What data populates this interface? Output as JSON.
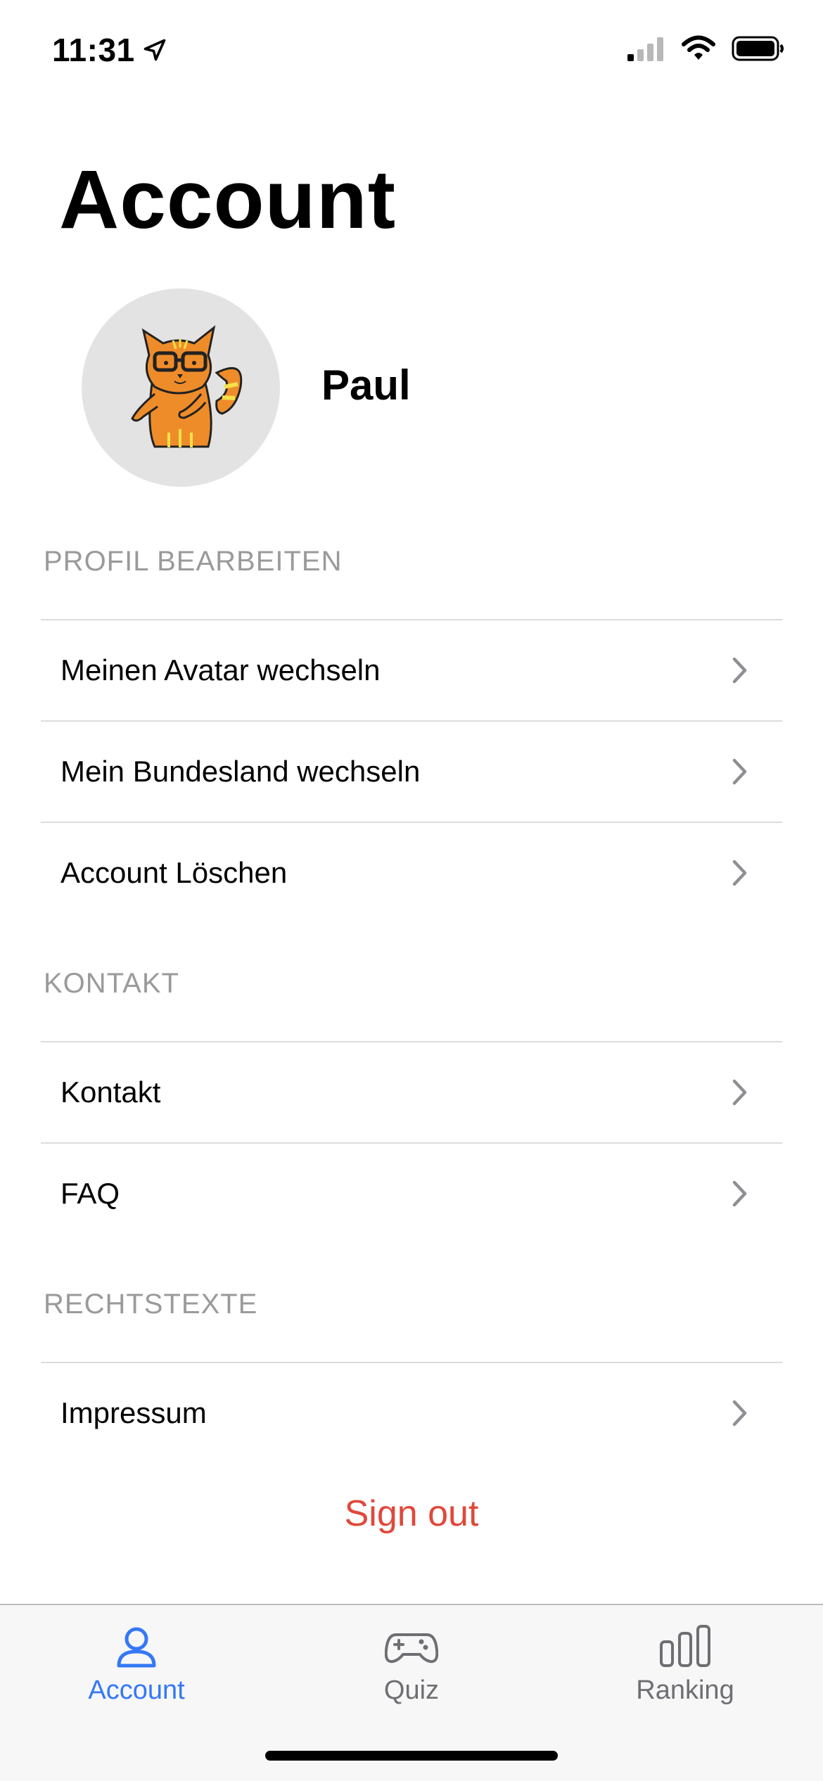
{
  "status_bar": {
    "time": "11:31"
  },
  "title": "Account",
  "profile": {
    "name": "Paul",
    "avatar": "cat-with-glasses"
  },
  "sections": [
    {
      "header": "PROFIL BEARBEITEN",
      "items": [
        "Meinen Avatar wechseln",
        "Mein Bundesland wechseln",
        "Account Löschen"
      ]
    },
    {
      "header": "KONTAKT",
      "items": [
        "Kontakt",
        "FAQ"
      ]
    },
    {
      "header": "RECHTSTEXTE",
      "items": [
        "Impressum"
      ]
    }
  ],
  "sign_out": "Sign out",
  "tabs": [
    {
      "label": "Account",
      "icon": "person-icon",
      "active": true
    },
    {
      "label": "Quiz",
      "icon": "gamepad-icon",
      "active": false
    },
    {
      "label": "Ranking",
      "icon": "bar-chart-icon",
      "active": false
    }
  ],
  "colors": {
    "accent": "#3478f6",
    "destructive": "#e0483b",
    "secondary_text": "#9a9a9a",
    "inactive_tab": "#8e8e93"
  }
}
